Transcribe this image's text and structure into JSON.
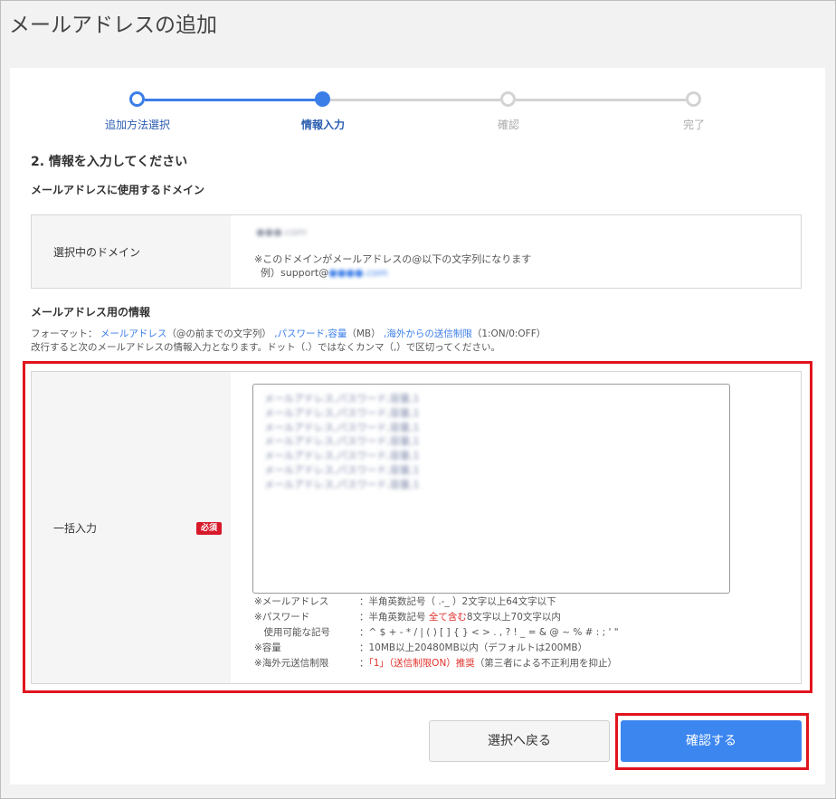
{
  "page": {
    "title": "メールアドレスの追加"
  },
  "stepper": {
    "steps": [
      {
        "label": "追加方法選択",
        "state": "done"
      },
      {
        "label": "情報入力",
        "state": "current"
      },
      {
        "label": "確認",
        "state": "pending"
      },
      {
        "label": "完了",
        "state": "pending"
      }
    ]
  },
  "section": {
    "heading": "2. 情報を入力してください",
    "domain_heading": "メールアドレスに使用するドメイン",
    "domain_row_label": "選択中のドメイン",
    "domain_value_redacted": "●●●.com",
    "domain_note": "※このドメインがメールアドレスの@以下の文字列になります",
    "domain_example_prefix": "例）support@",
    "domain_example_redacted": "●●●●.com",
    "info_heading": "メールアドレス用の情報",
    "format_label": "フォーマット：",
    "format_email": "メールアドレス",
    "format_email_desc": "（@の前までの文字列）",
    "format_password": ",パスワード",
    "format_capacity": ",容量",
    "format_capacity_unit": "（MB）",
    "format_overseas": ",海外からの送信制限",
    "format_overseas_desc": "（1:ON/0:OFF）",
    "format_note": "改行すると次のメールアドレスの情報入力となります。ドット（.）ではなくカンマ（,）で区切ってください。"
  },
  "bulk": {
    "label": "一括入力",
    "required_badge": "必須",
    "textarea_lines_redacted": [
      "メールアドレス,パスワード,容量,1",
      "メールアドレス,パスワード,容量,1",
      "メールアドレス,パスワード,容量,1",
      "メールアドレス,パスワード,容量,1",
      "メールアドレス,パスワード,容量,1",
      "メールアドレス,パスワード,容量,1",
      "メールアドレス,パスワード,容量,1"
    ],
    "rules": [
      {
        "key": "※メールアドレス",
        "value": "：半角英数記号（ .-_ ）2文字以上64文字以下"
      },
      {
        "key": "※パスワード",
        "value_prefix": "：半角英数記号 ",
        "value_red": "全て含む",
        "value_suffix": "8文字以上70文字以内"
      },
      {
        "key": "　使用可能な記号",
        "value": "：^ $ + - * / | ( ) [ ] { } < > . , ? ! _ = & @ ~ % # : ; ' \""
      },
      {
        "key": "※容量",
        "value": "：10MB以上20480MB以内（デフォルトは200MB）"
      },
      {
        "key": "※海外元送信制限",
        "value_prefix": "：",
        "value_red": "「1」（送信制限ON）推奨",
        "value_suffix": "（第三者による不正利用を抑止）"
      }
    ]
  },
  "buttons": {
    "back": "選択へ戻る",
    "confirm": "確認する"
  },
  "colors": {
    "accent": "#3b7ee8",
    "highlight": "#e0141e",
    "required": "#d7192a"
  }
}
